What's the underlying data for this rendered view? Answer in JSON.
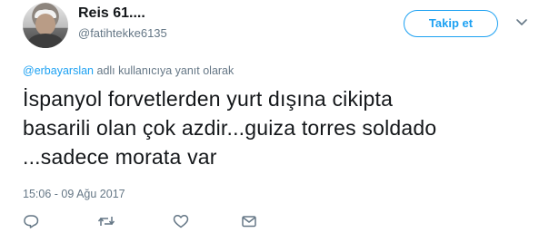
{
  "user": {
    "display_name": "Reis 61....",
    "handle": "@fatihtekke6135"
  },
  "follow_button": {
    "label": "Takip et"
  },
  "menu_icon": "chevron-down-icon",
  "reply_context": {
    "mention": "@erbayarslan",
    "suffix": " adlı kullanıcıya yanıt olarak"
  },
  "tweet": {
    "text": "İspanyol forvetlerden yurt dışına cikipta\nbasarili olan çok azdir...guiza torres soldado\n...sadece morata var",
    "timestamp": "15:06 - 09 Ağu 2017"
  },
  "actions": [
    {
      "icon": "reply-icon"
    },
    {
      "icon": "retweet-icon"
    },
    {
      "icon": "like-icon"
    },
    {
      "icon": "message-icon"
    }
  ],
  "colors": {
    "accent": "#1da1f2",
    "secondary_text": "#657786",
    "primary_text": "#14171a"
  }
}
